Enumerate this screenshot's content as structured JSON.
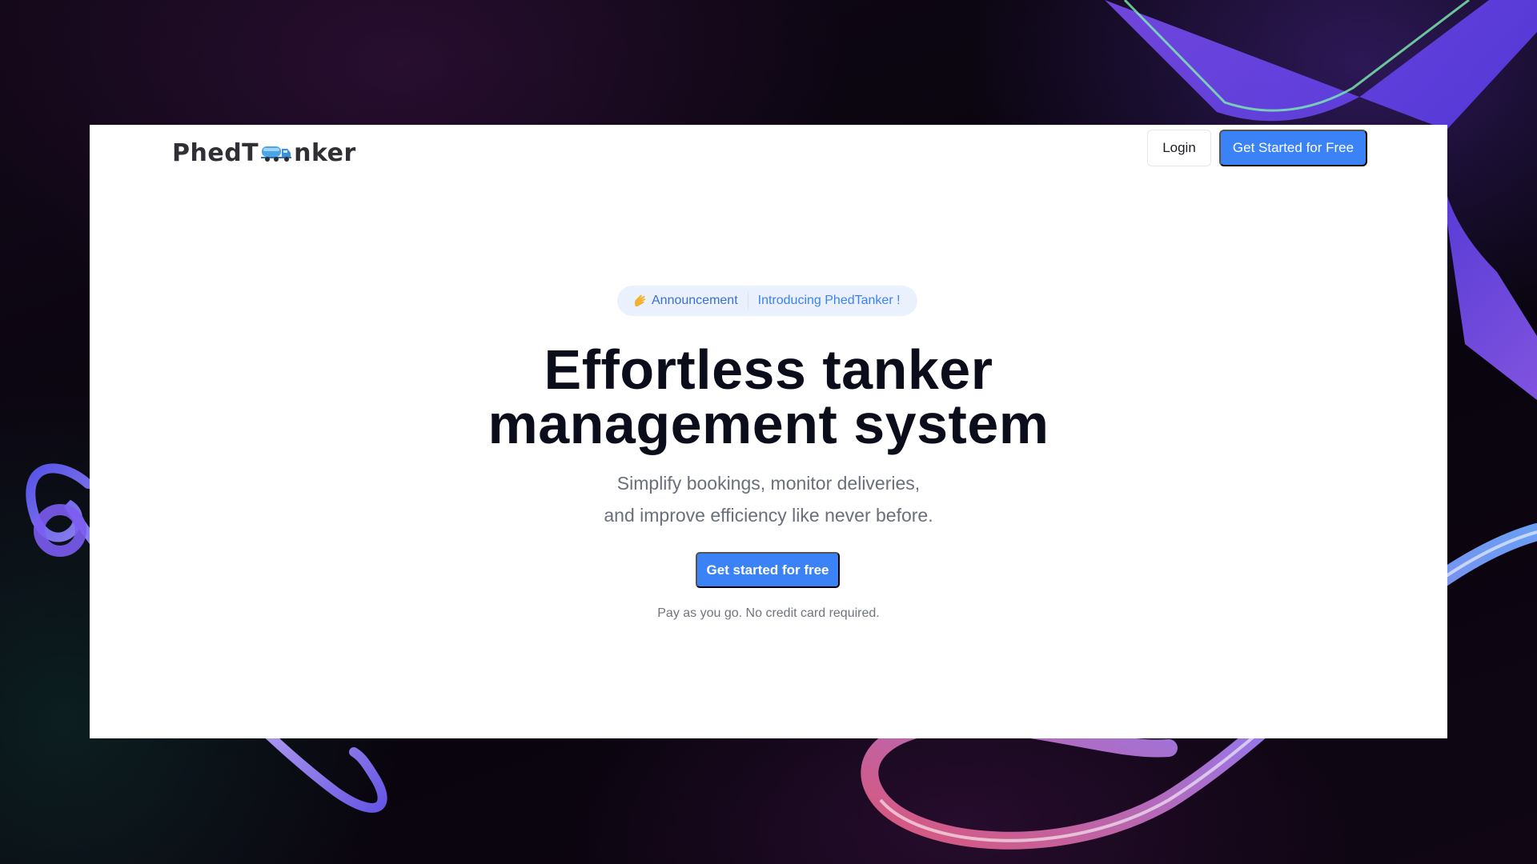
{
  "brand": {
    "logo_prefix": "PhedT",
    "logo_suffix": "nker",
    "logo_icon": "tanker-truck-icon",
    "accent": "#3a82f6"
  },
  "nav": {
    "login_label": "Login",
    "cta_label": "Get Started for Free"
  },
  "announcement": {
    "icon": "hand-icon",
    "tag": "Announcement",
    "text": "Introducing PhedTanker !"
  },
  "hero": {
    "title_line1": "Effortless tanker",
    "title_line2": "management system",
    "subtitle_line1": "Simplify bookings, monitor deliveries,",
    "subtitle_line2": "and improve efficiency like never before.",
    "cta_label": "Get started for free",
    "note": "Pay as you go. No credit card required."
  }
}
